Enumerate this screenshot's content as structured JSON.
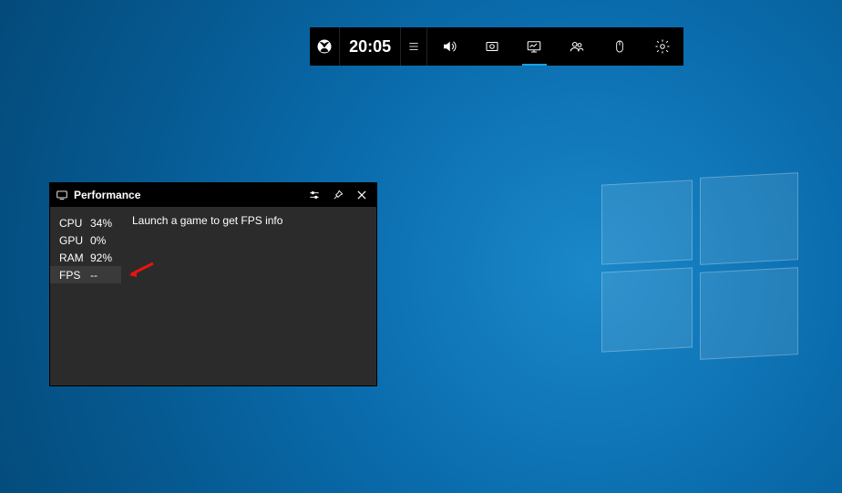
{
  "gamebar": {
    "time": "20:05"
  },
  "performance": {
    "title": "Performance",
    "message": "Launch a game to get FPS info",
    "stats": {
      "cpu_label": "CPU",
      "cpu_val": "34%",
      "gpu_label": "GPU",
      "gpu_val": "0%",
      "ram_label": "RAM",
      "ram_val": "92%",
      "fps_label": "FPS",
      "fps_val": "--"
    }
  }
}
